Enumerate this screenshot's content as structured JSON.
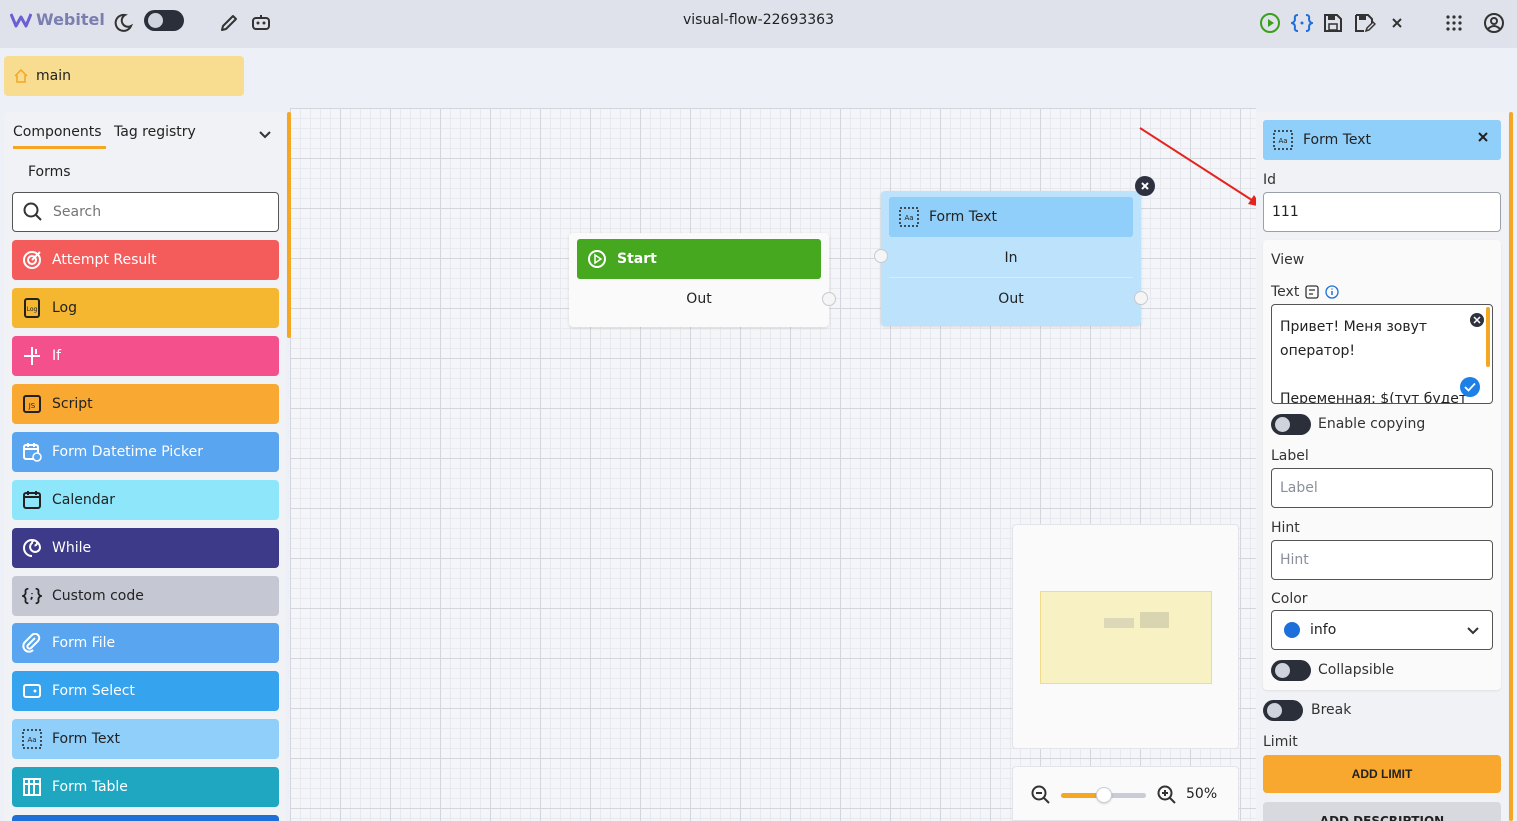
{
  "app": {
    "logo_text": "Webitel",
    "title": "visual-flow-22693363"
  },
  "breadcrumb": {
    "label": "main"
  },
  "sidebar": {
    "tabs": [
      "Components",
      "Tag registry"
    ],
    "section": "Forms",
    "search_placeholder": "Search",
    "items": [
      {
        "label": "Attempt Result",
        "color": "#f45b5b",
        "icon": "target-icon"
      },
      {
        "label": "Log",
        "color": "#f4b72f",
        "icon": "log-icon"
      },
      {
        "label": "If",
        "color": "#f4518c",
        "icon": "branch-icon"
      },
      {
        "label": "Script",
        "color": "#f9a932",
        "icon": "js-icon"
      },
      {
        "label": "Form Datetime Picker",
        "color": "#5aa5ef",
        "icon": "calendar-clock-icon"
      },
      {
        "label": "Calendar",
        "color": "#8ee6fb",
        "icon": "calendar-icon"
      },
      {
        "label": "While",
        "color": "#3e3a8a",
        "icon": "loop-icon"
      },
      {
        "label": "Custom code",
        "color": "#c5c7d3",
        "icon": "braces-icon"
      },
      {
        "label": "Form File",
        "color": "#5aa5ef",
        "icon": "paperclip-icon"
      },
      {
        "label": "Form Select",
        "color": "#36a3ef",
        "icon": "select-icon"
      },
      {
        "label": "Form Text",
        "color": "#8fcffa",
        "icon": "text-field-icon"
      },
      {
        "label": "Form Table",
        "color": "#1fa7c2",
        "icon": "table-icon"
      }
    ]
  },
  "nodes": {
    "start": {
      "title": "Start",
      "out": "Out"
    },
    "form_text": {
      "title": "Form Text",
      "in": "In",
      "out": "Out"
    }
  },
  "zoom": {
    "value": 50,
    "label": "50%"
  },
  "panel": {
    "title": "Form Text",
    "id_label": "Id",
    "id_value": "111",
    "view_label": "View",
    "text_label": "Text",
    "text_lines": [
      "Привет! Меня зовут",
      "оператор!",
      "",
      "Переменная: $(тут будет"
    ],
    "enable_copying": "Enable copying",
    "label_label": "Label",
    "label_placeholder": "Label",
    "hint_label": "Hint",
    "hint_placeholder": "Hint",
    "color_label": "Color",
    "color_value": "info",
    "collapsible": "Collapsible",
    "break": "Break",
    "limit_label": "Limit",
    "add_limit": "ADD LIMIT",
    "add_description": "ADD DESCRIPTION"
  }
}
